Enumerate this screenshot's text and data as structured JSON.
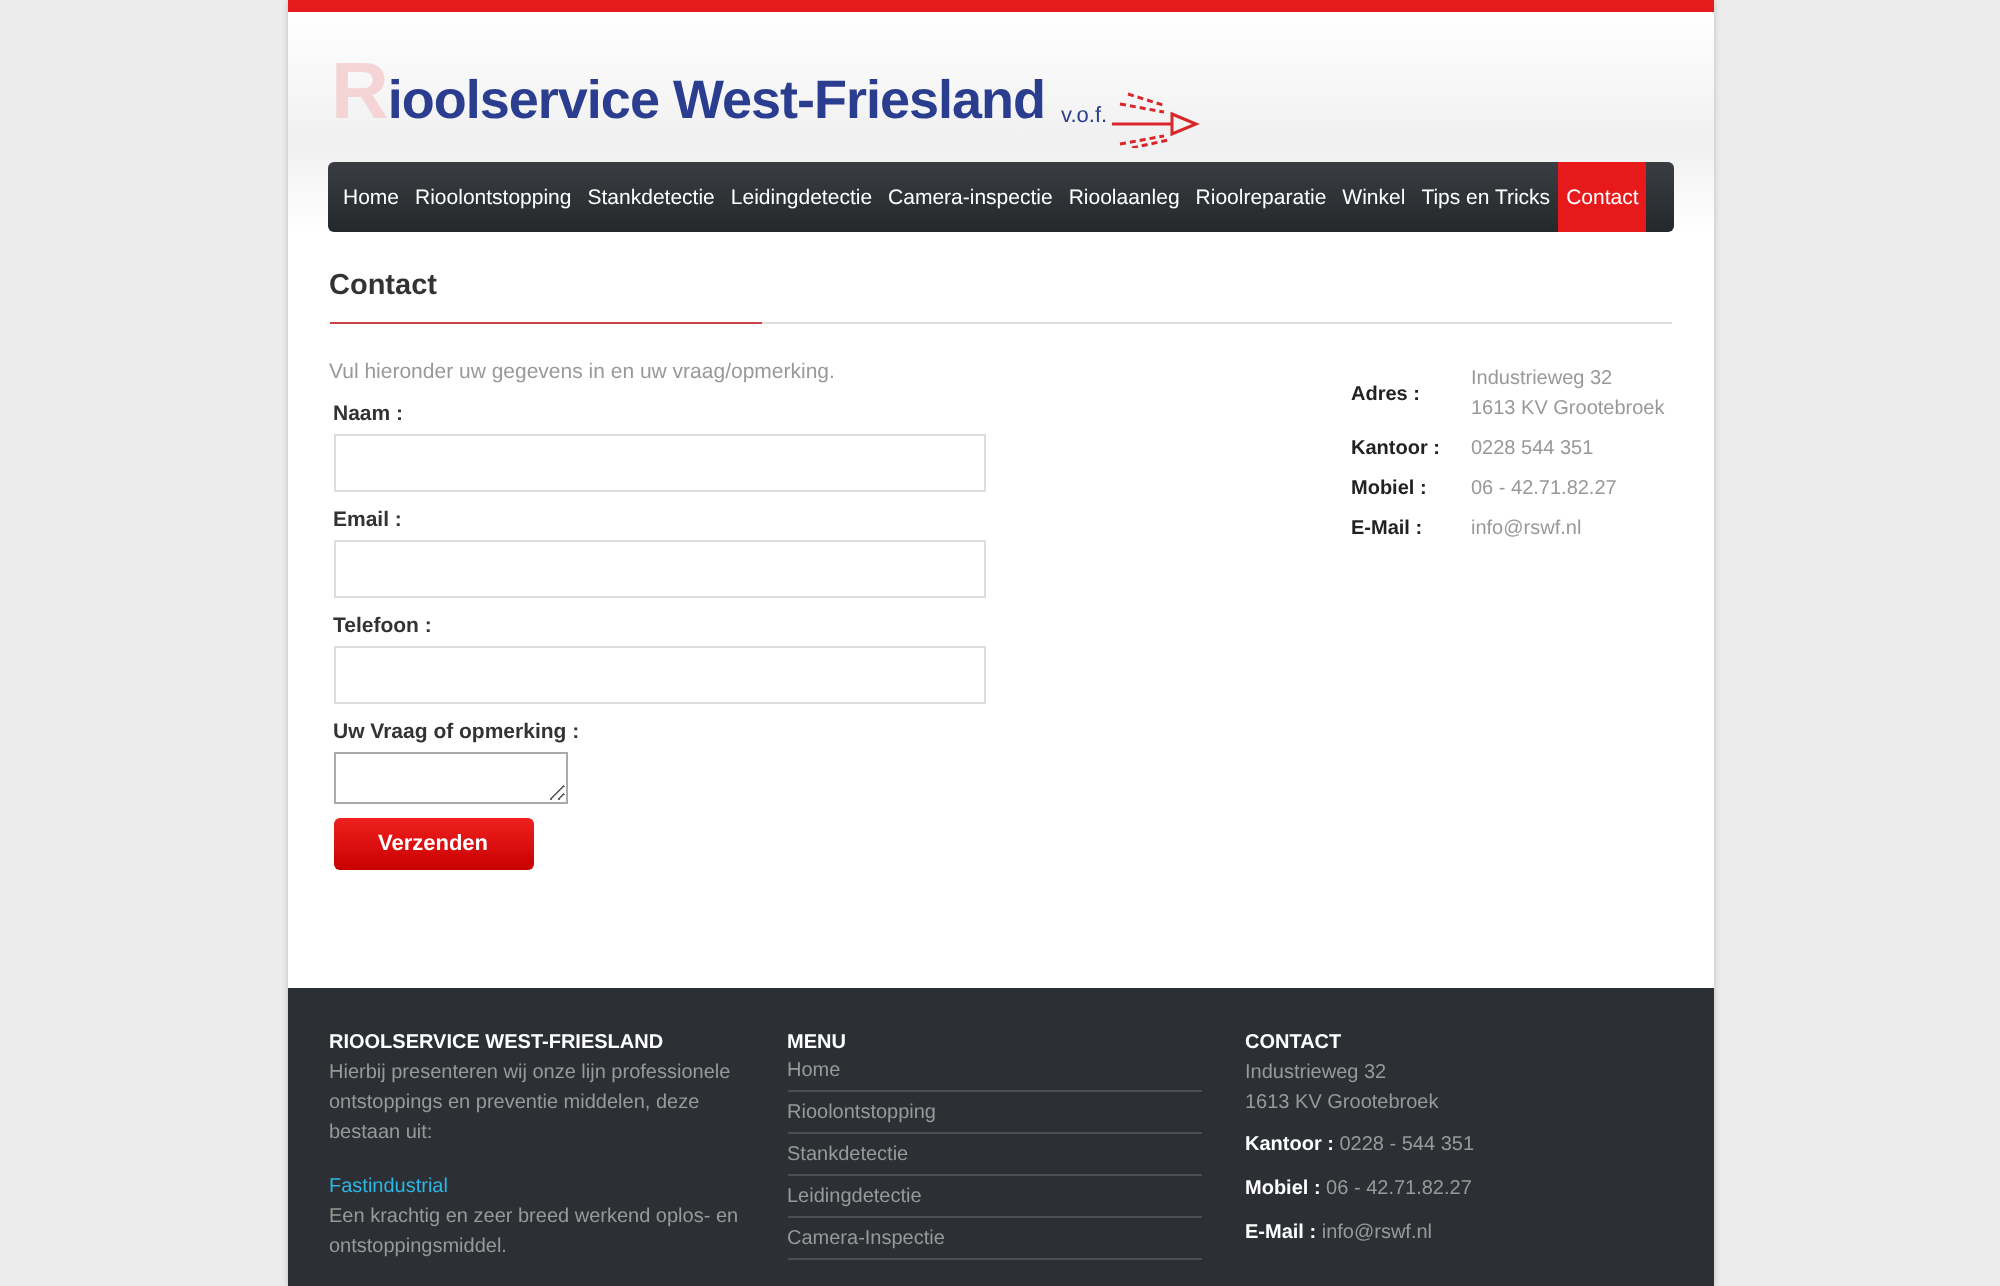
{
  "logo": {
    "name": "Rioolservice West-Friesland",
    "suffix": "v.o.f."
  },
  "nav": [
    {
      "label": "Home",
      "selected": false
    },
    {
      "label": "Rioolontstopping",
      "selected": false
    },
    {
      "label": "Stankdetectie",
      "selected": false
    },
    {
      "label": "Leidingdetectie",
      "selected": false
    },
    {
      "label": "Camera-inspectie",
      "selected": false
    },
    {
      "label": "Rioolaanleg",
      "selected": false
    },
    {
      "label": "Rioolreparatie",
      "selected": false
    },
    {
      "label": "Winkel",
      "selected": false
    },
    {
      "label": "Tips en Tricks",
      "selected": false
    },
    {
      "label": "Contact",
      "selected": true
    }
  ],
  "page_title": "Contact",
  "intro": "Vul hieronder uw gegevens in en uw vraag/opmerking.",
  "form": {
    "fields": [
      {
        "label": "Naam :",
        "kind": "input"
      },
      {
        "label": "Email :",
        "kind": "input"
      },
      {
        "label": "Telefoon :",
        "kind": "input"
      },
      {
        "label": "Uw Vraag of opmerking :",
        "kind": "textarea"
      }
    ],
    "submit": "Verzenden"
  },
  "address": [
    {
      "label": "Adres :",
      "lines": [
        "Industrieweg 32",
        "1613 KV Grootebroek"
      ]
    },
    {
      "label": "Kantoor :",
      "lines": [
        "0228 544 351"
      ]
    },
    {
      "label": "Mobiel :",
      "lines": [
        "06 - 42.71.82.27"
      ]
    },
    {
      "label": "E-Mail :",
      "lines": [
        "info@rswf.nl"
      ]
    }
  ],
  "footer": {
    "about": {
      "title": "RIOOLSERVICE WEST-FRIESLAND",
      "text": "Hierbij presenteren wij onze lijn professionele ontstoppings en preventie middelen, deze bestaan uit:",
      "link": "Fastindustrial",
      "link_text": "Een krachtig en zeer breed werkend oplos- en ontstoppingsmiddel."
    },
    "menu": {
      "title": "MENU",
      "items": [
        "Home",
        "Rioolontstopping",
        "Stankdetectie",
        "Leidingdetectie",
        "Camera-Inspectie"
      ]
    },
    "contact": {
      "title": "CONTACT",
      "address": [
        "Industrieweg 32",
        "1613 KV Grootebroek"
      ],
      "lines": [
        "**Kantoor :** 0228 - 544 351",
        "**Mobiel :** 06 - 42.71.82.27",
        "**E-Mail :** info@rswf.nl"
      ]
    }
  }
}
